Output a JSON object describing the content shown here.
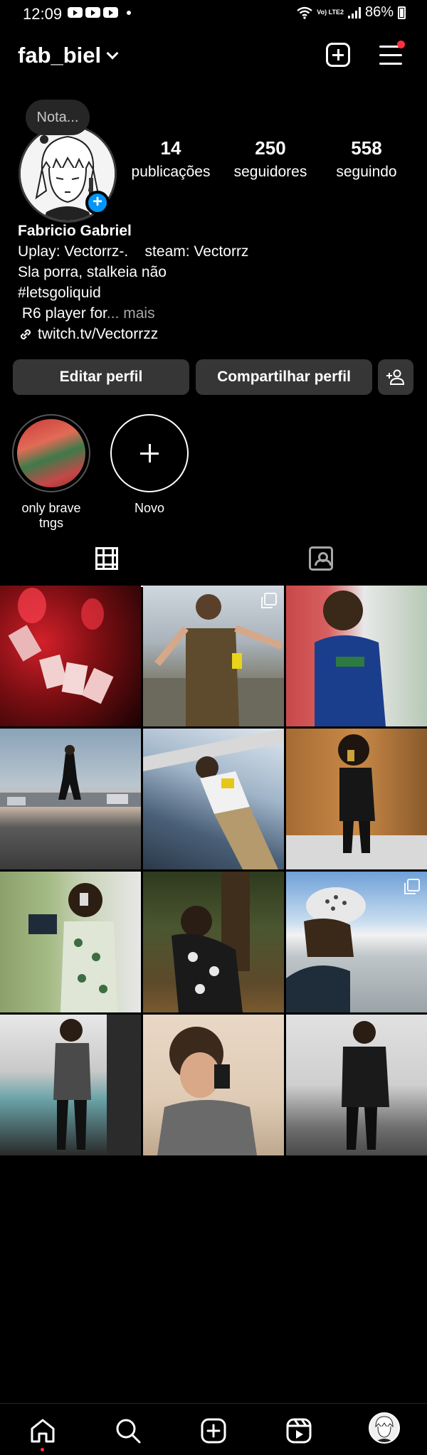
{
  "status_bar": {
    "time": "12:09",
    "network": "Vo) LTE2",
    "battery": "86%"
  },
  "header": {
    "username": "fab_biel"
  },
  "profile": {
    "note_placeholder": "Nota...",
    "stats": [
      {
        "value": "14",
        "label": "publicações"
      },
      {
        "value": "250",
        "label": "seguidores"
      },
      {
        "value": "558",
        "label": "seguindo"
      }
    ],
    "name": "Fabricio Gabriel",
    "bio_lines": [
      "Uplay: Vectorrz-.    steam: Vectorrz",
      "Sla porra, stalkeia não",
      "#letsgoliquid"
    ],
    "bio_truncated": " R6 player for",
    "bio_more": "... mais",
    "link": "twitch.tv/Vectorrzz"
  },
  "actions": {
    "edit_label": "Editar perfil",
    "share_label": "Compartilhar perfil"
  },
  "highlights": [
    {
      "label": "only brave tngs"
    },
    {
      "label": "Novo"
    }
  ],
  "colors": {
    "accent": "#0095f6",
    "notification": "#ff3040",
    "button_bg": "#363636"
  },
  "icons": [
    "youtube-icon",
    "wifi-icon",
    "signal-icon",
    "battery-icon",
    "chevron-down-icon",
    "plus-square-icon",
    "menu-icon",
    "link-icon",
    "add-user-icon",
    "grid-icon",
    "tagged-icon",
    "home-icon",
    "search-icon",
    "create-icon",
    "reels-icon"
  ]
}
